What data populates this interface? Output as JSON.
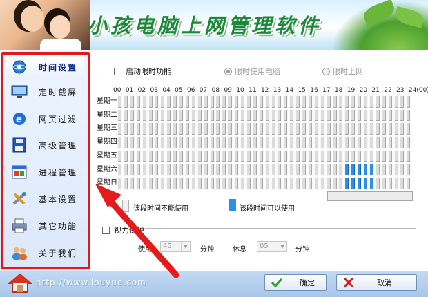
{
  "header": {
    "title": "小孩电脑上网管理软件"
  },
  "sidebar": {
    "items": [
      {
        "label": "时间设置",
        "icon": "clock-globe-icon",
        "active": true
      },
      {
        "label": "定时截屏",
        "icon": "monitor-icon"
      },
      {
        "label": "网页过滤",
        "icon": "browser-e-icon"
      },
      {
        "label": "高级管理",
        "icon": "floppy-disk-icon"
      },
      {
        "label": "进程管理",
        "icon": "process-window-icon"
      },
      {
        "label": "基本设置",
        "icon": "tools-icon"
      },
      {
        "label": "其它功能",
        "icon": "printer-icon"
      },
      {
        "label": "关于我们",
        "icon": "people-icon"
      }
    ]
  },
  "main": {
    "enable_limit_label": "启动限时功能",
    "radio_limit_pc_label": "限时使用电脑",
    "radio_limit_net_label": "限时上网",
    "hours": [
      "00",
      "01",
      "02",
      "03",
      "04",
      "05",
      "06",
      "07",
      "08",
      "09",
      "10",
      "11",
      "12",
      "13",
      "14",
      "15",
      "16",
      "17",
      "18",
      "19",
      "20",
      "21",
      "22",
      "23",
      "24(00)"
    ],
    "days": [
      "星期一",
      "星期二",
      "星期三",
      "星期四",
      "星期五",
      "星期六",
      "星期日"
    ],
    "allowed_slots": [
      {
        "day": "星期六",
        "from": "18:30",
        "to": "21:00"
      },
      {
        "day": "星期日",
        "from": "18:30",
        "to": "21:00"
      }
    ],
    "legend_blocked": "该段时间不能使用",
    "legend_allowed": "该段时间可以使用",
    "eye_protection_label": "视力保护",
    "use_label": "使用",
    "use_value": "45",
    "use_unit": "分钟",
    "rest_label": "休息",
    "rest_value": "05",
    "rest_unit": "分钟"
  },
  "footer": {
    "url": "http://www.louyue.com",
    "ok_label": "确定",
    "cancel_label": "取消"
  },
  "colors": {
    "allowed": "#2f8fe6",
    "blocked": "#dcdcdc",
    "highlight_frame": "#e01a1a"
  }
}
